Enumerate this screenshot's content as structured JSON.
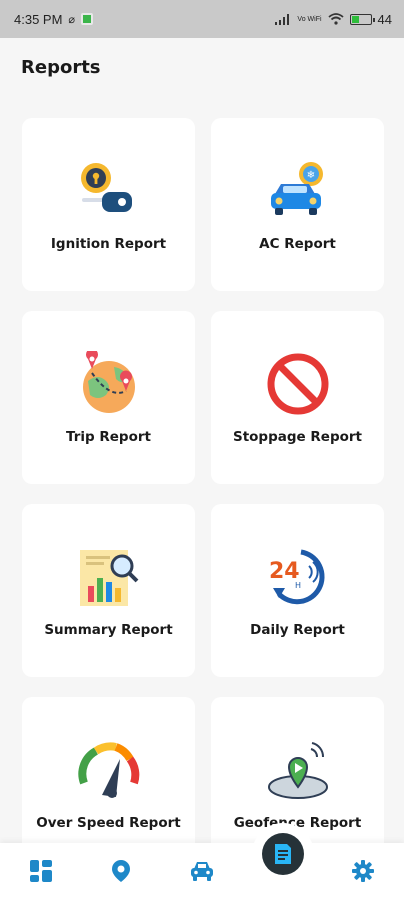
{
  "status_bar": {
    "time": "4:35 PM",
    "network": "Vo WiFi",
    "battery": "44",
    "battery_level": 0.44
  },
  "page": {
    "title": "Reports"
  },
  "reports": [
    {
      "label": "Ignition Report",
      "icon": "ignition-key-icon"
    },
    {
      "label": "AC Report",
      "icon": "car-ac-icon"
    },
    {
      "label": "Trip Report",
      "icon": "globe-route-icon"
    },
    {
      "label": "Stoppage Report",
      "icon": "no-stop-icon"
    },
    {
      "label": "Summary Report",
      "icon": "summary-chart-icon"
    },
    {
      "label": "Daily Report",
      "icon": "24-hours-icon"
    },
    {
      "label": "Over Speed Report",
      "icon": "speedometer-icon"
    },
    {
      "label": "Geofence Report",
      "icon": "geofence-icon"
    }
  ],
  "bottom_nav": {
    "items": [
      "dashboard-icon",
      "location-pin-icon",
      "car-icon",
      "reports-icon",
      "settings-icon"
    ],
    "active": "reports-icon"
  },
  "colors": {
    "accent": "#1e88c8",
    "active_bg": "#263238"
  }
}
